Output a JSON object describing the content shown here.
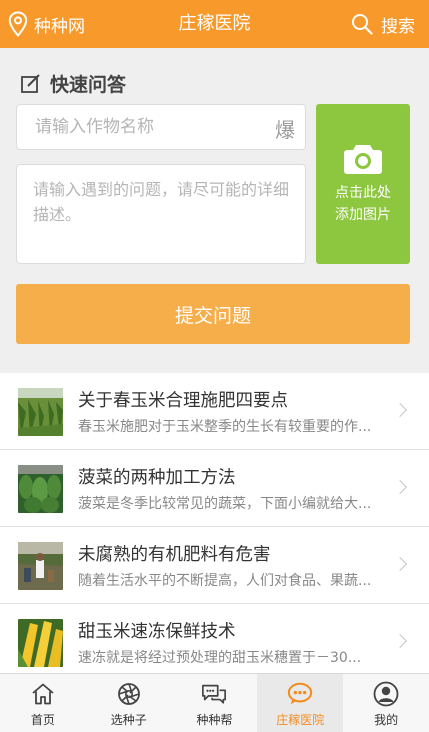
{
  "header": {
    "brand": "种种网",
    "title": "庄稼医院",
    "search_label": "搜索"
  },
  "qa": {
    "heading": "快速问答",
    "crop_placeholder": "请输入作物名称",
    "voice_glyph": "爆",
    "desc_placeholder": "请输入遇到的问题，请尽可能的详细描述。",
    "photo_line1": "点击此处",
    "photo_line2": "添加图片",
    "submit_label": "提交问题"
  },
  "articles": [
    {
      "title": "关于春玉米合理施肥四要点",
      "summary": "春玉米施肥对于玉米整季的生长有较重要的作..."
    },
    {
      "title": "菠菜的两种加工方法",
      "summary": "菠菜是冬季比较常见的蔬菜，下面小编就给大..."
    },
    {
      "title": "未腐熟的有机肥料有危害",
      "summary": "随着生活水平的不断提高，人们对食品、果蔬..."
    },
    {
      "title": "甜玉米速冻保鲜技术",
      "summary": "速冻就是将经过预处理的甜玉米穗置于－30..."
    }
  ],
  "nav": [
    {
      "label": "首页",
      "icon": "home-icon"
    },
    {
      "label": "选种子",
      "icon": "aperture-icon"
    },
    {
      "label": "种种帮",
      "icon": "chat-bubbles-icon"
    },
    {
      "label": "庄稼医院",
      "icon": "message-dots-icon",
      "active": true
    },
    {
      "label": "我的",
      "icon": "user-icon"
    }
  ],
  "colors": {
    "header": "#f89a2b",
    "photo_button": "#8dc63f",
    "submit_button": "#f6ae4a",
    "active_nav": "#f28c1f"
  }
}
